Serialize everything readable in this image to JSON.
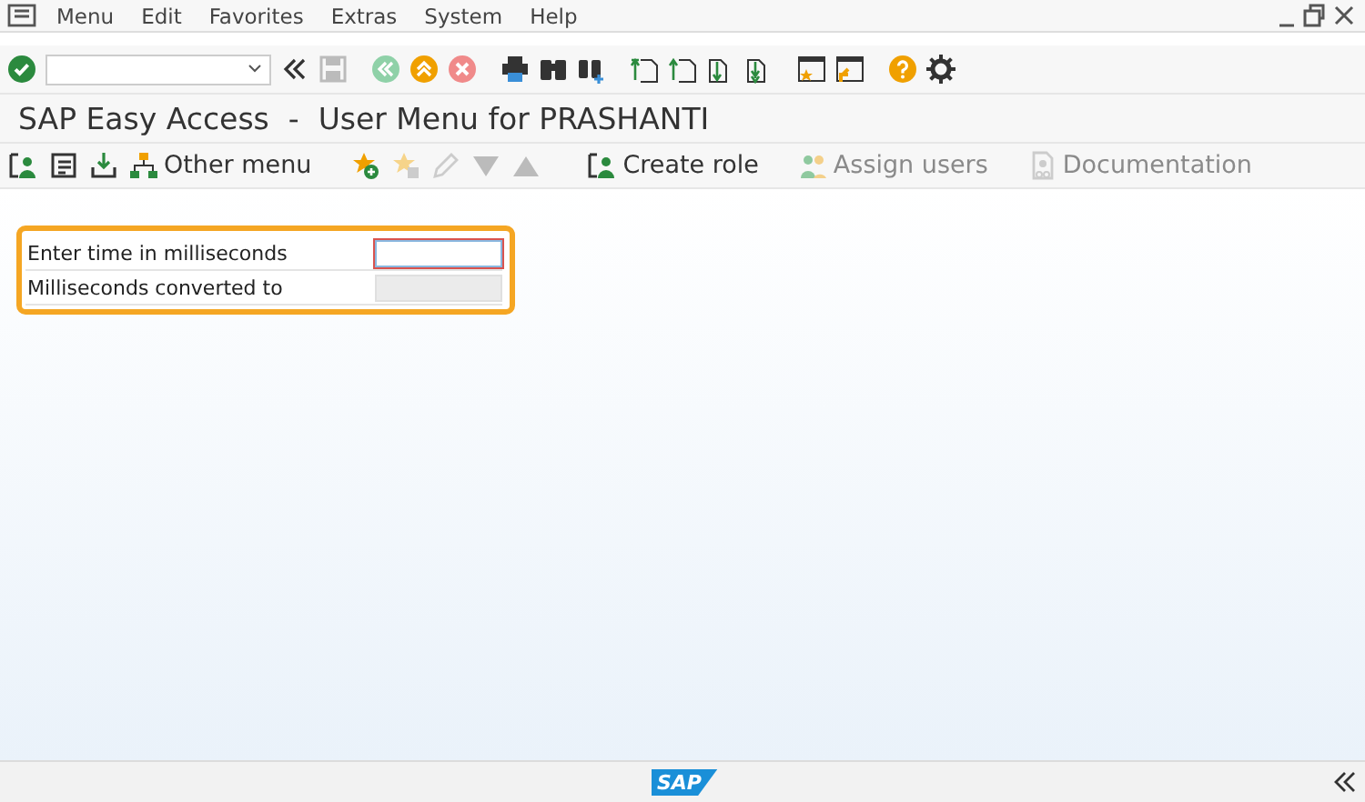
{
  "menu_bar": {
    "items": [
      "Menu",
      "Edit",
      "Favorites",
      "Extras",
      "System",
      "Help"
    ]
  },
  "title": "SAP Easy Access  -  User Menu for PRASHANTI",
  "app_toolbar": {
    "buttons": [
      {
        "label": "Other menu",
        "disabled": false
      },
      {
        "label": "Create role",
        "disabled": false
      },
      {
        "label": "Assign users",
        "disabled": true
      },
      {
        "label": "Documentation",
        "disabled": true
      }
    ]
  },
  "form": {
    "rows": [
      {
        "label": "Enter time in milliseconds",
        "kind": "input",
        "focused": true
      },
      {
        "label": "Milliseconds converted to",
        "kind": "output",
        "focused": false
      }
    ]
  },
  "status_bar": {
    "logo": "SAP"
  }
}
